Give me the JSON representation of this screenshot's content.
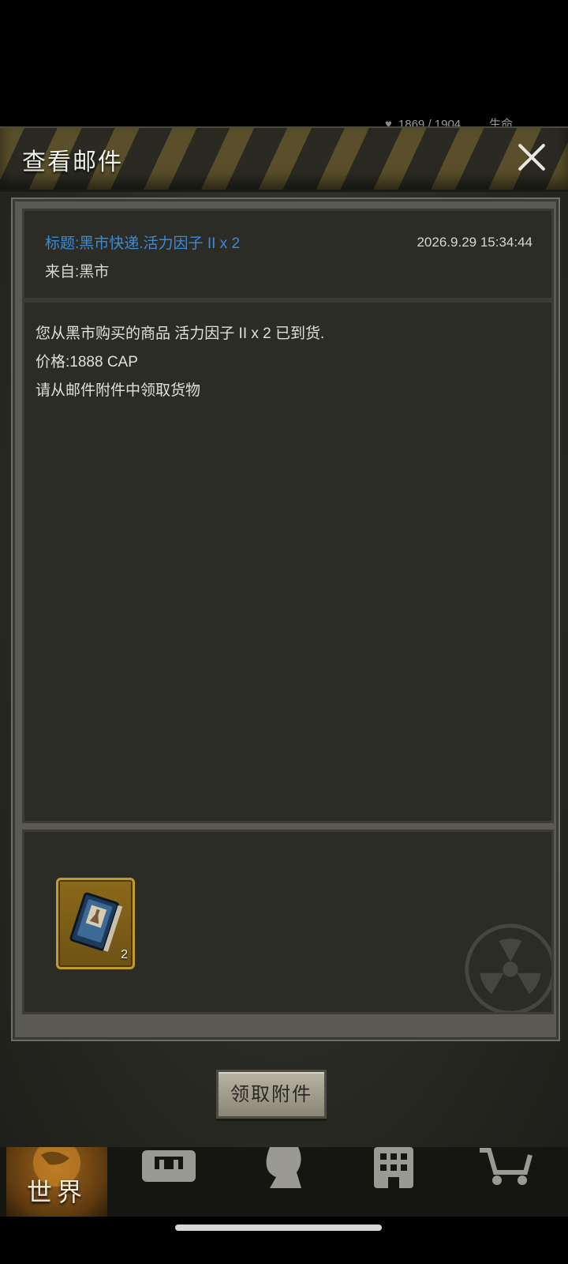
{
  "background_status": {
    "hp": "1869 / 1904",
    "life_label": "生命"
  },
  "dialog": {
    "title": "查看邮件",
    "mail": {
      "subject": "标题:黑市快递.活力因子 II x 2",
      "date": "2026.9.29 15:34:44",
      "from": "来自:黑市",
      "body_lines": [
        "您从黑市购买的商品 活力因子 II  x 2 已到货.",
        "价格:1888 CAP",
        "请从邮件附件中领取货物"
      ]
    },
    "attachments": [
      {
        "icon": "book-icon",
        "count": "2"
      }
    ],
    "claim_button": "领取附件"
  },
  "nav": {
    "world_label": "世界",
    "icons": [
      "backpack-icon",
      "character-icon",
      "building-icon",
      "cart-icon"
    ]
  },
  "colors": {
    "subject_blue": "#3c8ad6",
    "item_frame_gold": "#c49a28",
    "world_tab_orange": "#a0661c"
  }
}
